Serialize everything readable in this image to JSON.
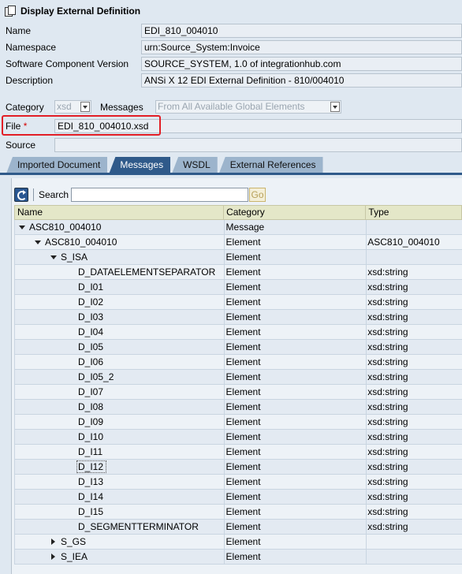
{
  "window": {
    "title": "Display External Definition",
    "title_icon": "documents-icon"
  },
  "form": {
    "name_label": "Name",
    "name_value": "EDI_810_004010",
    "namespace_label": "Namespace",
    "namespace_value": "urn:Source_System:Invoice",
    "swcv_label": "Software Component Version",
    "swcv_value": "SOURCE_SYSTEM, 1.0 of integrationhub.com",
    "description_label": "Description",
    "description_value": "ANSi X 12 EDI External Definition - 810/004010",
    "category_label": "Category",
    "category_value": "xsd",
    "messages_label": "Messages",
    "messages_value": "From All Available Global Elements",
    "file_label": "File",
    "file_required_marker": "*",
    "file_value": "EDI_810_004010.xsd",
    "source_label": "Source",
    "source_value": ""
  },
  "tabs": [
    {
      "label": "Imported Document",
      "active": false
    },
    {
      "label": "Messages",
      "active": true
    },
    {
      "label": "WSDL",
      "active": false
    },
    {
      "label": "External References",
      "active": false
    }
  ],
  "toolbar": {
    "search_label": "Search",
    "search_value": "",
    "go_label": "Go",
    "refresh_icon": "refresh-icon"
  },
  "grid": {
    "columns": [
      "Name",
      "Category",
      "Type"
    ],
    "rows": [
      {
        "name": "ASC810_004010",
        "category": "Message",
        "type": "",
        "level": 0,
        "toggle": "expanded"
      },
      {
        "name": "ASC810_004010",
        "category": "Element",
        "type": "ASC810_004010",
        "level": 1,
        "toggle": "expanded"
      },
      {
        "name": "S_ISA",
        "category": "Element",
        "type": "",
        "level": 2,
        "toggle": "expanded"
      },
      {
        "name": "D_DATAELEMENTSEPARATOR",
        "category": "Element",
        "type": "xsd:string",
        "level": 3,
        "toggle": "none"
      },
      {
        "name": "D_I01",
        "category": "Element",
        "type": "xsd:string",
        "level": 3,
        "toggle": "none"
      },
      {
        "name": "D_I02",
        "category": "Element",
        "type": "xsd:string",
        "level": 3,
        "toggle": "none"
      },
      {
        "name": "D_I03",
        "category": "Element",
        "type": "xsd:string",
        "level": 3,
        "toggle": "none"
      },
      {
        "name": "D_I04",
        "category": "Element",
        "type": "xsd:string",
        "level": 3,
        "toggle": "none"
      },
      {
        "name": "D_I05",
        "category": "Element",
        "type": "xsd:string",
        "level": 3,
        "toggle": "none"
      },
      {
        "name": "D_I06",
        "category": "Element",
        "type": "xsd:string",
        "level": 3,
        "toggle": "none"
      },
      {
        "name": "D_I05_2",
        "category": "Element",
        "type": "xsd:string",
        "level": 3,
        "toggle": "none"
      },
      {
        "name": "D_I07",
        "category": "Element",
        "type": "xsd:string",
        "level": 3,
        "toggle": "none"
      },
      {
        "name": "D_I08",
        "category": "Element",
        "type": "xsd:string",
        "level": 3,
        "toggle": "none"
      },
      {
        "name": "D_I09",
        "category": "Element",
        "type": "xsd:string",
        "level": 3,
        "toggle": "none"
      },
      {
        "name": "D_I10",
        "category": "Element",
        "type": "xsd:string",
        "level": 3,
        "toggle": "none"
      },
      {
        "name": "D_I11",
        "category": "Element",
        "type": "xsd:string",
        "level": 3,
        "toggle": "none"
      },
      {
        "name": "D_I12",
        "category": "Element",
        "type": "xsd:string",
        "level": 3,
        "toggle": "none",
        "focused": true
      },
      {
        "name": "D_I13",
        "category": "Element",
        "type": "xsd:string",
        "level": 3,
        "toggle": "none"
      },
      {
        "name": "D_I14",
        "category": "Element",
        "type": "xsd:string",
        "level": 3,
        "toggle": "none"
      },
      {
        "name": "D_I15",
        "category": "Element",
        "type": "xsd:string",
        "level": 3,
        "toggle": "none"
      },
      {
        "name": "D_SEGMENTTERMINATOR",
        "category": "Element",
        "type": "xsd:string",
        "level": 3,
        "toggle": "none"
      },
      {
        "name": "S_GS",
        "category": "Element",
        "type": "",
        "level": 2,
        "toggle": "collapsed"
      },
      {
        "name": "S_IEA",
        "category": "Element",
        "type": "",
        "level": 2,
        "toggle": "collapsed"
      }
    ]
  },
  "colors": {
    "highlight_box": "#e21e26",
    "active_tab": "#2f5a8a",
    "inactive_tab": "#9cb4cc",
    "grid_header": "#e4e7c8"
  }
}
